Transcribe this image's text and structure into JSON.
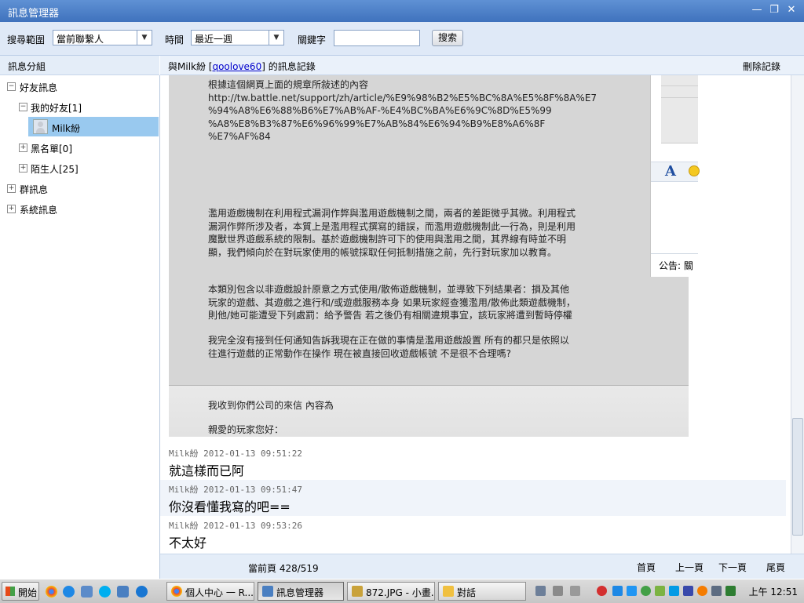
{
  "window": {
    "title": "訊息管理器"
  },
  "toolbar": {
    "scope_label": "搜尋範圍",
    "scope_value": "當前聯繫人",
    "time_label": "時間",
    "time_value": "最近一週",
    "keyword_label": "關鍵字",
    "keyword_value": "",
    "search_label": "搜索"
  },
  "sidebar": {
    "header": "訊息分組",
    "tree": {
      "friends": "好友訊息",
      "my_friends": "我的好友[1]",
      "contact": "Milk紛",
      "blacklist": "黑名單[0]",
      "strangers": "陌生人[25]",
      "groups": "群訊息",
      "system": "系統訊息"
    }
  },
  "header": {
    "prefix": "與Milk紛 [",
    "account": "qoolove60",
    "suffix": "] 的訊息記錄",
    "delete_label": "刪除記錄"
  },
  "embedded_image": {
    "para1": "根據這個網頁上面的規章所敍述的內容\nhttp://tw.battle.net/support/zh/article/%E9%98%B2%E5%BC%8A%E5%8F%8A%E7\n%94%A8%E6%88%B6%E7%AB%AF-%E4%BC%BA%E6%9C%8D%E5%99\n%A8%E8%B3%87%E6%96%99%E7%AB%84%E6%94%B9%E8%A6%8F\n%E7%AF%84",
    "para2": "濫用遊戲機制在利用程式漏洞作弊與濫用遊戲機制之間，兩者的差距微乎其微。利用程式\n漏洞作弊所涉及者，本質上是濫用程式撰寫的錯誤，而濫用遊戲機制此一行為，則是利用\n魔獸世界遊戲系統的限制。基於遊戲機制許可下的使用與濫用之間，其界線有時並不明\n顯，我們傾向於在對玩家使用的帳號採取任何抵制措施之前，先行對玩家加以教育。",
    "para3": "本類別包含以非遊戲設計原意之方式使用/散佈遊戲機制，並導致下列結果者：損及其他\n玩家的遊戲、其遊戲之進行和/或遊戲服務本身 如果玩家經查獲濫用/散佈此類遊戲機制，\n則他/她可能遭受下列處罰：給予警告 若之後仍有相關違規事宜，該玩家將遭到暫時停權",
    "para4": "我完全沒有接到任何通知告訴我現在正在做的事情是濫用遊戲設置 所有的都只是依照以\n往進行遊戲的正常動作在操作 現在被直接回收遊戲帳號 不是很不合理嗎?",
    "para5": "我收到你們公司的來信 內容為",
    "para6": "親愛的玩家您好：",
    "announce": "公告: 關"
  },
  "messages": [
    {
      "sender": "Milk紛",
      "time": "2012-01-13 09:51:22",
      "text": "就這樣而已阿"
    },
    {
      "sender": "Milk紛",
      "time": "2012-01-13 09:51:47",
      "text": "你沒看懂我寫的吧=="
    },
    {
      "sender": "Milk紛",
      "time": "2012-01-13 09:53:26",
      "text": "不太好"
    }
  ],
  "pager": {
    "current": "當前頁 428/519",
    "first": "首頁",
    "prev": "上一頁",
    "next": "下一頁",
    "last": "尾頁"
  },
  "taskbar": {
    "start": "開始",
    "tasks": [
      "個人中心 一 R...",
      "訊息管理器",
      "872.JPG - 小畫...",
      "對話"
    ],
    "clock": "上午 12:51"
  },
  "colors": {
    "titlebar": "#4f82c9",
    "selection": "#99c9ef",
    "link": "#0000cc"
  }
}
